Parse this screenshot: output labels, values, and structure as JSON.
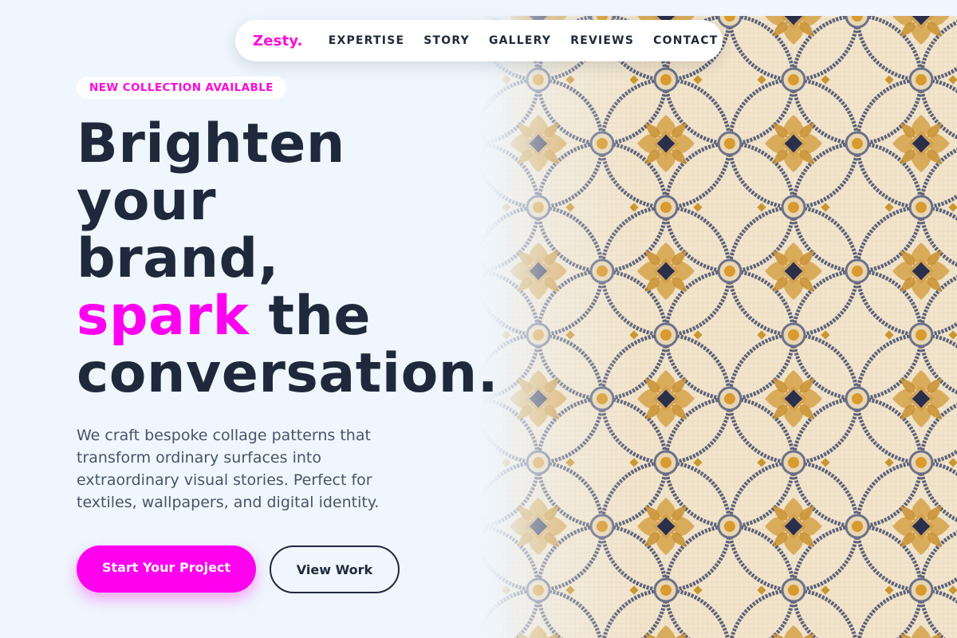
{
  "brand": {
    "logo": "Zesty.",
    "accent_color": "#ff00f0",
    "text_color": "#1e293b"
  },
  "nav": {
    "links": [
      "EXPERTISE",
      "STORY",
      "GALLERY",
      "REVIEWS",
      "CONTACT"
    ]
  },
  "hero": {
    "badge": "NEW COLLECTION AVAILABLE",
    "headline": {
      "line1": "Brighten",
      "line2": "your",
      "line3": "brand,",
      "accent_word": "spark",
      "line4_rest": " the",
      "line5": "conversation."
    },
    "description_lines": [
      "We craft bespoke collage patterns that",
      "transform ordinary surfaces into",
      "extraordinary visual stories. Perfect for",
      "textiles, wallpapers, and digital identity."
    ],
    "primary_cta": "Start Your Project",
    "secondary_cta": "View Work",
    "image_icon": "mosaic-pattern-image"
  }
}
